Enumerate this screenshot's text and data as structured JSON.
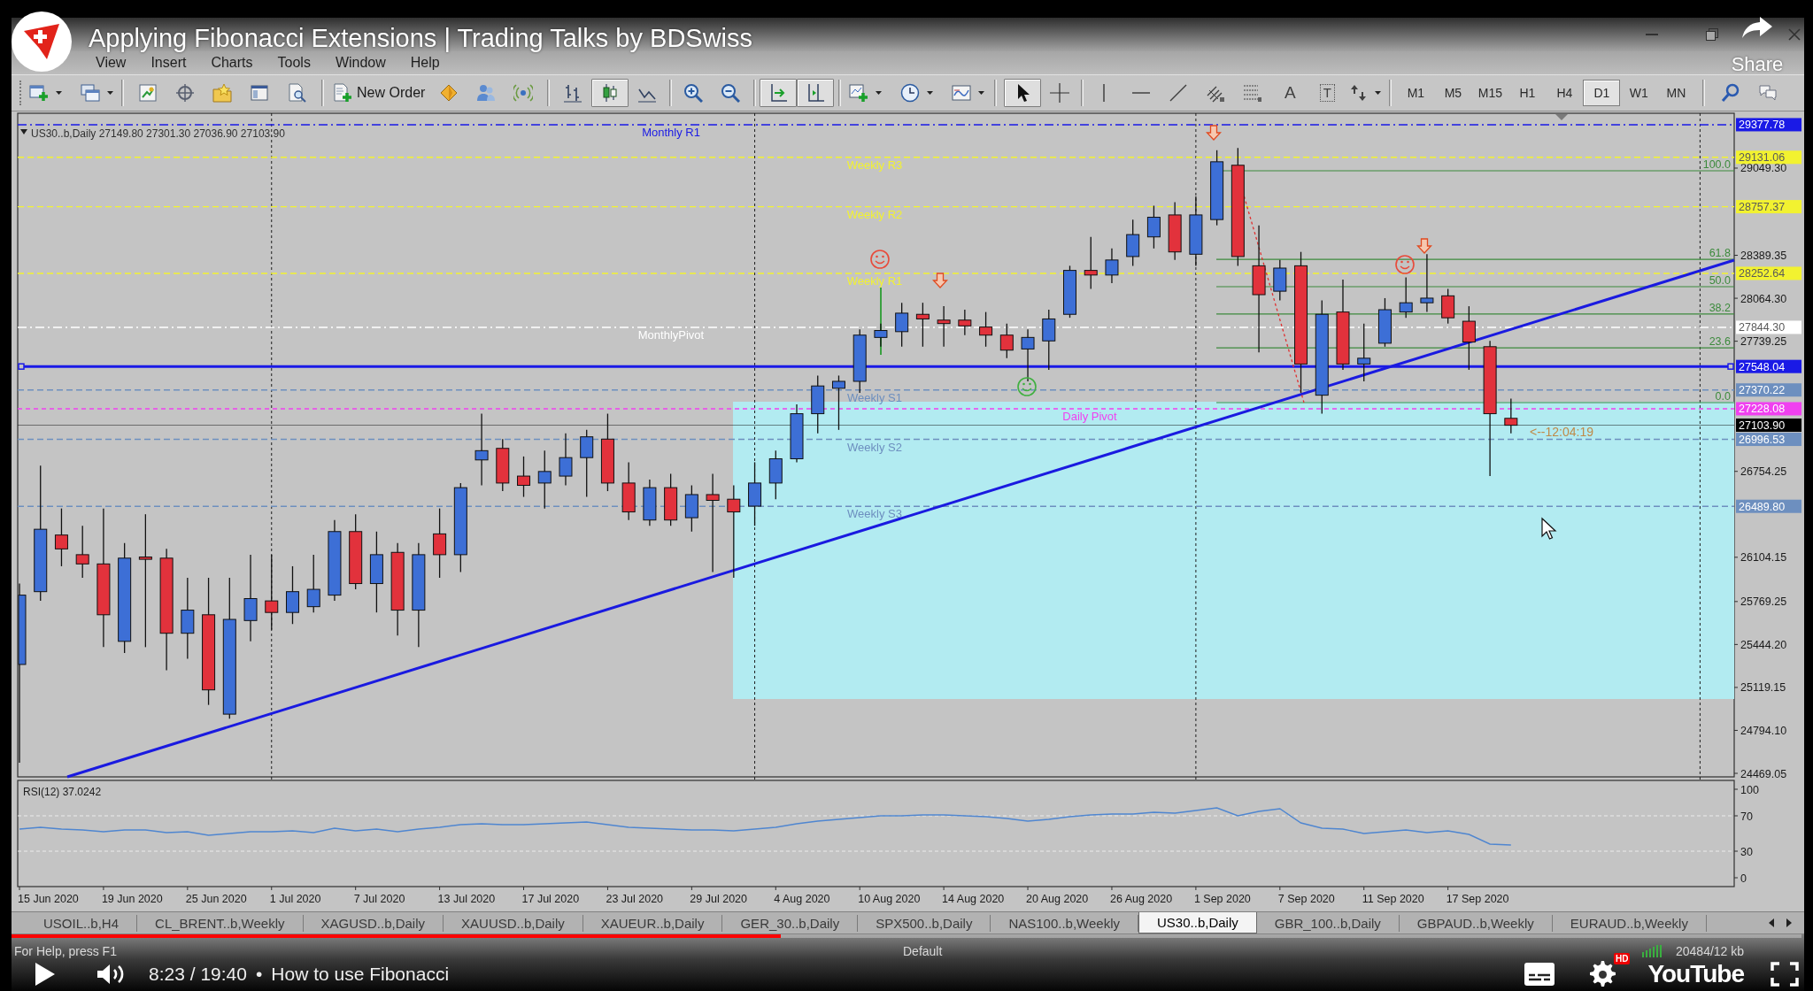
{
  "player": {
    "title": "Applying Fibonacci Extensions | Trading Talks by BDSwiss",
    "share": "Share",
    "progress": {
      "level": 0.43
    },
    "time": "8:23 / 19:40",
    "separator": "•",
    "chapter": "How to use Fibonacci",
    "hd": "HD",
    "logo": "YouTube"
  },
  "menu": [
    "View",
    "Insert",
    "Charts",
    "Tools",
    "Window",
    "Help"
  ],
  "toolbar": {
    "new_order": "New Order",
    "chart_modes": [
      {
        "kind": "bars",
        "selected": false
      },
      {
        "kind": "candles",
        "selected": true
      },
      {
        "kind": "line",
        "selected": false
      }
    ],
    "view_toggles": [
      {
        "kind": "autoscroll",
        "selected": true
      },
      {
        "kind": "shift",
        "selected": true
      }
    ],
    "pointers": [
      {
        "kind": "cursor",
        "selected": true
      },
      {
        "kind": "crosshair",
        "selected": false
      }
    ],
    "text_tool": "A",
    "label_tool": "T",
    "timeframes": [
      {
        "label": "M1",
        "selected": false
      },
      {
        "label": "M5",
        "selected": false
      },
      {
        "label": "M15",
        "selected": false
      },
      {
        "label": "H1",
        "selected": false
      },
      {
        "label": "H4",
        "selected": false
      },
      {
        "label": "D1",
        "selected": true
      },
      {
        "label": "W1",
        "selected": false
      },
      {
        "label": "MN",
        "selected": false
      }
    ]
  },
  "chart": {
    "header": "US30..b,Daily 27149.80 27301.30 27036.90 27103.90",
    "levels": [
      {
        "kind": "monthly",
        "label": "Monthly R1",
        "tag": "29377.78",
        "color": "#1a1ae6"
      },
      {
        "kind": "weekly",
        "label": "Weekly R3",
        "tag": "29131.06",
        "color": "#f2f230"
      },
      {
        "kind": "weekly",
        "label": "Weekly R2",
        "tag": "28757.37",
        "color": "#f2f230"
      },
      {
        "kind": "weekly",
        "label": "Weekly R1",
        "tag": "28252.64",
        "color": "#f2f230"
      },
      {
        "kind": "monthly",
        "label": "MonthlyPivot",
        "tag": "27844.30",
        "color": "#ffffff"
      },
      {
        "kind": "line",
        "tag": "27548.04",
        "color": "#1a1ae6"
      },
      {
        "kind": "weekly",
        "label": "Weekly S1",
        "tag": "27370.22",
        "color": "#6d8fbf"
      },
      {
        "kind": "daily",
        "label": "Daily Pivot",
        "tag": "27228.08",
        "color": "#f040f0"
      },
      {
        "kind": "price",
        "tag": "27103.90",
        "color": "#000000"
      },
      {
        "kind": "weekly",
        "label": "Weekly S2",
        "tag": "26996.53",
        "color": "#6d8fbf"
      },
      {
        "kind": "weekly",
        "label": "Weekly S3",
        "tag": "26489.80",
        "color": "#6d8fbf"
      }
    ],
    "price_ticks": [
      "29049.30",
      "28389.35",
      "28064.30",
      "27739.25",
      "26754.25",
      "26104.15",
      "25769.25",
      "25444.20",
      "25119.15",
      "24794.10",
      "24469.05"
    ],
    "fib_levels": [
      "100.0",
      "61.8",
      "50.0",
      "38.2",
      "23.6",
      "0.0"
    ],
    "timer": "<--12:04:19",
    "dates": [
      "15 Jun 2020",
      "19 Jun 2020",
      "25 Jun 2020",
      "1 Jul 2020",
      "7 Jul 2020",
      "13 Jul 2020",
      "17 Jul 2020",
      "23 Jul 2020",
      "29 Jul 2020",
      "4 Aug 2020",
      "10 Aug 2020",
      "14 Aug 2020",
      "20 Aug 2020",
      "26 Aug 2020",
      "1 Sep 2020",
      "7 Sep 2020",
      "11 Sep 2020",
      "17 Sep 2020"
    ]
  },
  "rsi": {
    "chart_data": {
      "type": "line",
      "title": "RSI(12) 37.0242",
      "ylim": [
        -10,
        110
      ],
      "yticks": [
        0,
        30,
        70,
        100
      ],
      "series": [
        {
          "color": "#4f86d0",
          "values": [
            55,
            57,
            55,
            54,
            52,
            54,
            54,
            51,
            52,
            48,
            50,
            52,
            52,
            53,
            51,
            56,
            53,
            55,
            52,
            55,
            57,
            60,
            61,
            60,
            60,
            61,
            62,
            63,
            60,
            57,
            56,
            55,
            54,
            54,
            53,
            55,
            57,
            61,
            64,
            66,
            68,
            70,
            70,
            71,
            71,
            70,
            69,
            67,
            64,
            66,
            69,
            71,
            72,
            72,
            74,
            73,
            76,
            79,
            70,
            75,
            78,
            62,
            56,
            55,
            50,
            52,
            54,
            51,
            53,
            49,
            38,
            37
          ]
        }
      ]
    }
  },
  "tabs": [
    {
      "label": "USOIL..b,H4",
      "selected": false
    },
    {
      "label": "CL_BRENT..b,Weekly",
      "selected": false
    },
    {
      "label": "XAGUSD..b,Daily",
      "selected": false
    },
    {
      "label": "XAUUSD..b,Daily",
      "selected": false
    },
    {
      "label": "XAUEUR..b,Daily",
      "selected": false
    },
    {
      "label": "GER_30..b,Daily",
      "selected": false
    },
    {
      "label": "SPX500..b,Daily",
      "selected": false
    },
    {
      "label": "NAS100..b,Weekly",
      "selected": false
    },
    {
      "label": "US30..b,Daily",
      "selected": true
    },
    {
      "label": "GBR_100..b,Daily",
      "selected": false
    },
    {
      "label": "GBPAUD..b,Weekly",
      "selected": false
    },
    {
      "label": "EURAUD..b,Weekly",
      "selected": false
    }
  ],
  "status": {
    "help": "For Help, press F1",
    "profile": "Default",
    "traffic": "20484/12 kb"
  }
}
